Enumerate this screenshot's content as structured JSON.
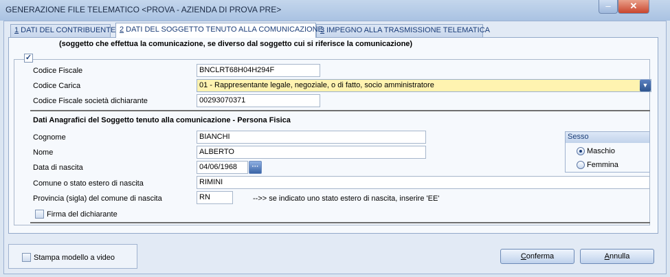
{
  "window": {
    "title": "GENERAZIONE FILE TELEMATICO <PROVA - AZIENDA DI PROVA PRE>",
    "close_glyph": "✕",
    "minimize_glyph": "–"
  },
  "tabs": [
    {
      "key": "1",
      "rest": " DATI DEL CONTRIBUENTE"
    },
    {
      "key": "2",
      "rest": " DATI DEL SOGGETTO TENUTO ALLA COMUNICAZIONE"
    },
    {
      "key": "3",
      "rest": " IMPEGNO ALLA TRASMISSIONE TELEMATICA"
    }
  ],
  "note": "(soggetto che effettua la comunicazione, se diverso dal soggetto cui si riferisce la comunicazione)",
  "fields": {
    "codice_fiscale": {
      "label": "Codice Fiscale",
      "value": "BNCLRT68H04H294F"
    },
    "codice_carica": {
      "label": "Codice Carica",
      "value": "01 - Rappresentante legale, negoziale, o di fatto, socio amministratore"
    },
    "cf_societa": {
      "label": "Codice Fiscale società dichiarante",
      "value": "00293070371"
    }
  },
  "anagrafica": {
    "heading": "Dati Anagrafici del Soggetto tenuto alla comunicazione - Persona Fisica",
    "cognome": {
      "label": "Cognome",
      "value": "BIANCHI"
    },
    "nome": {
      "label": "Nome",
      "value": "ALBERTO"
    },
    "data_nascita": {
      "label": "Data di nascita",
      "value": "04/06/1968",
      "btn": "···"
    },
    "comune": {
      "label": "Comune o stato estero di nascita",
      "value": "RIMINI"
    },
    "provincia": {
      "label": "Provincia (sigla) del comune di nascita",
      "value": "RN",
      "hint": "-->> se indicato uno stato estero di nascita, inserire 'EE'"
    },
    "firma": {
      "label": "Firma del dichiarante",
      "checked": false
    }
  },
  "sesso": {
    "title": "Sesso",
    "options": [
      "Maschio",
      "Femmina"
    ],
    "selected": "Maschio"
  },
  "footer": {
    "stampa_label": "Stampa modello a video",
    "conferma_key": "C",
    "conferma_rest": "onferma",
    "annulla_key": "A",
    "annulla_rest": "nnulla"
  },
  "colors": {
    "accent": "#1a3c78",
    "selection_bg": "#fff3b0"
  }
}
